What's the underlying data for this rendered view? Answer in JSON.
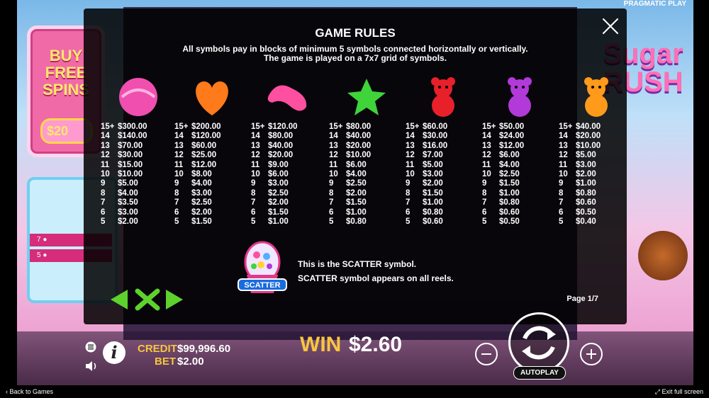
{
  "brand": "PRAGMATIC PLAY",
  "buy_panel": {
    "line1": "BUY",
    "line2": "FREE",
    "line3": "SPINS",
    "price": "$20"
  },
  "logo": {
    "line1": "Sugar",
    "line2": "RUSH"
  },
  "side_multipliers": [
    {
      "count": "7"
    },
    {
      "count": "5"
    }
  ],
  "modal": {
    "title": "GAME RULES",
    "desc_line1": "All symbols pay in blocks of minimum 5 symbols connected horizontally or vertically.",
    "desc_line2": "The game is played on a 7x7 grid of symbols.",
    "symbols": [
      {
        "icon": "pink-lollipop-icon",
        "color": "#f04fb0",
        "pays": [
          [
            "15+",
            "$300.00"
          ],
          [
            "14",
            "$140.00"
          ],
          [
            "13",
            "$70.00"
          ],
          [
            "12",
            "$30.00"
          ],
          [
            "11",
            "$15.00"
          ],
          [
            "10",
            "$10.00"
          ],
          [
            "9",
            "$5.00"
          ],
          [
            "8",
            "$4.00"
          ],
          [
            "7",
            "$3.50"
          ],
          [
            "6",
            "$3.00"
          ],
          [
            "5",
            "$2.00"
          ]
        ]
      },
      {
        "icon": "orange-heart-candy-icon",
        "color": "#ff7a1a",
        "pays": [
          [
            "15+",
            "$200.00"
          ],
          [
            "14",
            "$120.00"
          ],
          [
            "13",
            "$60.00"
          ],
          [
            "12",
            "$25.00"
          ],
          [
            "11",
            "$12.00"
          ],
          [
            "10",
            "$8.00"
          ],
          [
            "9",
            "$4.00"
          ],
          [
            "8",
            "$3.00"
          ],
          [
            "7",
            "$2.50"
          ],
          [
            "6",
            "$2.00"
          ],
          [
            "5",
            "$1.50"
          ]
        ]
      },
      {
        "icon": "pink-jellybean-icon",
        "color": "#ff4fa0",
        "pays": [
          [
            "15+",
            "$120.00"
          ],
          [
            "14",
            "$80.00"
          ],
          [
            "13",
            "$40.00"
          ],
          [
            "12",
            "$20.00"
          ],
          [
            "11",
            "$9.00"
          ],
          [
            "10",
            "$6.00"
          ],
          [
            "9",
            "$3.00"
          ],
          [
            "8",
            "$2.50"
          ],
          [
            "7",
            "$2.00"
          ],
          [
            "6",
            "$1.50"
          ],
          [
            "5",
            "$1.00"
          ]
        ]
      },
      {
        "icon": "green-star-candy-icon",
        "color": "#3fd43a",
        "pays": [
          [
            "15+",
            "$80.00"
          ],
          [
            "14",
            "$40.00"
          ],
          [
            "13",
            "$20.00"
          ],
          [
            "12",
            "$10.00"
          ],
          [
            "11",
            "$6.00"
          ],
          [
            "10",
            "$4.00"
          ],
          [
            "9",
            "$2.50"
          ],
          [
            "8",
            "$2.00"
          ],
          [
            "7",
            "$1.50"
          ],
          [
            "6",
            "$1.00"
          ],
          [
            "5",
            "$0.80"
          ]
        ]
      },
      {
        "icon": "red-gummy-bear-icon",
        "color": "#e8202a",
        "pays": [
          [
            "15+",
            "$60.00"
          ],
          [
            "14",
            "$30.00"
          ],
          [
            "13",
            "$16.00"
          ],
          [
            "12",
            "$7.00"
          ],
          [
            "11",
            "$5.00"
          ],
          [
            "10",
            "$3.00"
          ],
          [
            "9",
            "$2.00"
          ],
          [
            "8",
            "$1.50"
          ],
          [
            "7",
            "$1.00"
          ],
          [
            "6",
            "$0.80"
          ],
          [
            "5",
            "$0.60"
          ]
        ]
      },
      {
        "icon": "purple-gummy-bear-icon",
        "color": "#b23ad8",
        "pays": [
          [
            "15+",
            "$50.00"
          ],
          [
            "14",
            "$24.00"
          ],
          [
            "13",
            "$12.00"
          ],
          [
            "12",
            "$6.00"
          ],
          [
            "11",
            "$4.00"
          ],
          [
            "10",
            "$2.50"
          ],
          [
            "9",
            "$1.50"
          ],
          [
            "8",
            "$1.00"
          ],
          [
            "7",
            "$0.80"
          ],
          [
            "6",
            "$0.60"
          ],
          [
            "5",
            "$0.50"
          ]
        ]
      },
      {
        "icon": "orange-gummy-bear-icon",
        "color": "#ff9a1a",
        "pays": [
          [
            "15+",
            "$40.00"
          ],
          [
            "14",
            "$20.00"
          ],
          [
            "13",
            "$10.00"
          ],
          [
            "12",
            "$5.00"
          ],
          [
            "11",
            "$3.00"
          ],
          [
            "10",
            "$2.00"
          ],
          [
            "9",
            "$1.00"
          ],
          [
            "8",
            "$0.80"
          ],
          [
            "7",
            "$0.60"
          ],
          [
            "6",
            "$0.50"
          ],
          [
            "5",
            "$0.40"
          ]
        ]
      }
    ],
    "scatter": {
      "label": "SCATTER",
      "line1": "This is the SCATTER symbol.",
      "line2": "SCATTER symbol appears on all reels."
    },
    "page": "Page 1/7"
  },
  "hud": {
    "credit_label": "CREDIT",
    "credit_value": "$99,996.60",
    "bet_label": "BET",
    "bet_value": "$2.00",
    "win_label": "WIN",
    "win_value": "$2.60",
    "autoplay_label": "AUTOPLAY",
    "info_label": "i"
  },
  "status_bar": {
    "back": "Back to Games",
    "exit": "Exit full screen"
  }
}
